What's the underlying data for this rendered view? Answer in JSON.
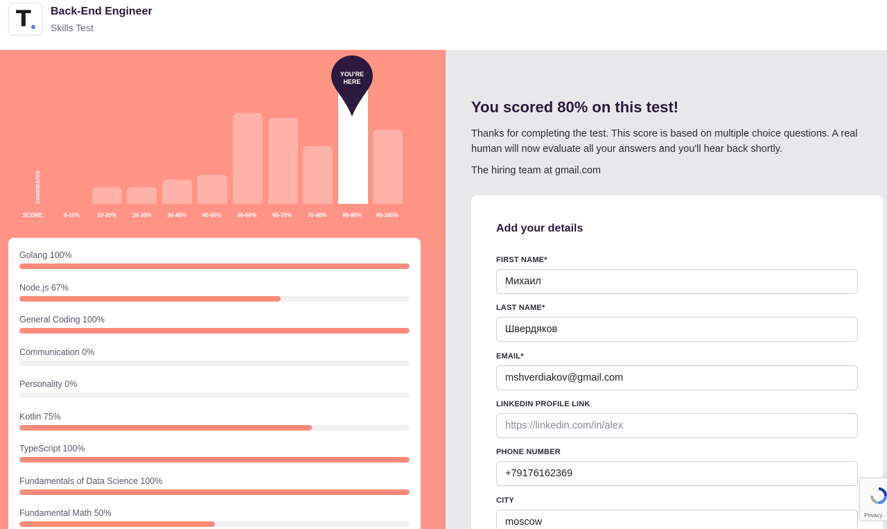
{
  "header": {
    "logo_letter": "T",
    "title": "Back-End Engineer",
    "subtitle": "Skills Test"
  },
  "chart_data": {
    "type": "bar",
    "ylabel": "CANDIDATES",
    "xlabel": "SCORE:",
    "categories": [
      "0-10%",
      "10-20%",
      "20-30%",
      "30-40%",
      "40-50%",
      "50-60%",
      "60-70%",
      "70-80%",
      "80-90%",
      "90-100%"
    ],
    "values": [
      0,
      18,
      18,
      27,
      32,
      100,
      95,
      63,
      100,
      82
    ],
    "highlight_index": 8,
    "highlight_label": "YOU'RE HERE",
    "colors": {
      "bar": "#ffb2a6",
      "highlight": "#ffffff",
      "pin": "#2b1a3d",
      "background": "#ff9485"
    }
  },
  "skills": [
    {
      "label": "Golang 100%",
      "value": 100
    },
    {
      "label": "Node.js 67%",
      "value": 67
    },
    {
      "label": "General Coding 100%",
      "value": 100
    },
    {
      "label": "Communication 0%",
      "value": 0
    },
    {
      "label": "Personality 0%",
      "value": 0
    },
    {
      "label": "Kotlin 75%",
      "value": 75
    },
    {
      "label": "TypeScript 100%",
      "value": 100
    },
    {
      "label": "Fundamentals of Data Science 100%",
      "value": 100
    },
    {
      "label": "Fundamental Math 50%",
      "value": 50
    }
  ],
  "result": {
    "title": "You scored 80% on this test!",
    "description": "Thanks for completing the test. This score is based on multiple choice questions. A real human will now evaluate all your answers and you'll hear back shortly.",
    "signature": "The hiring team at gmail.com"
  },
  "form": {
    "title": "Add your details",
    "fields": [
      {
        "label": "FIRST NAME*",
        "value": "Михаил",
        "placeholder": ""
      },
      {
        "label": "LAST NAME*",
        "value": "Швердяков",
        "placeholder": ""
      },
      {
        "label": "EMAIL*",
        "value": "mshverdiakov@gmail.com",
        "placeholder": ""
      },
      {
        "label": "LINKEDIN PROFILE LINK",
        "value": "",
        "placeholder": "https://linkedin.com/in/alex"
      },
      {
        "label": "PHONE NUMBER",
        "value": "+79176162369",
        "placeholder": ""
      },
      {
        "label": "CITY",
        "value": "moscow",
        "placeholder": ""
      }
    ]
  },
  "recaptcha": {
    "text": "Privacy -",
    "icon": "recaptcha-icon"
  }
}
